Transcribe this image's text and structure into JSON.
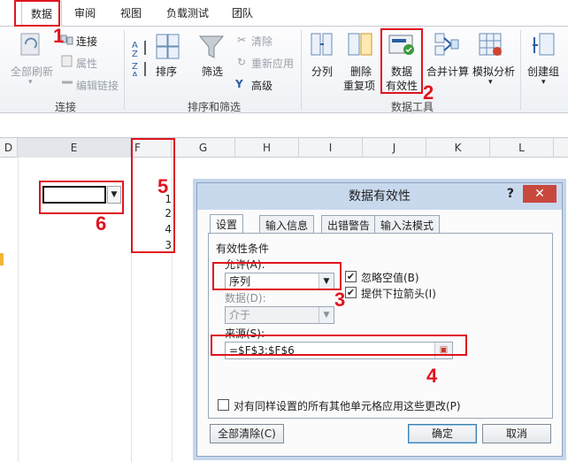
{
  "ribbon_tabs": [
    "数据",
    "审阅",
    "视图",
    "负载测试",
    "团队"
  ],
  "ribbon": {
    "refresh_all": "全部刷新",
    "connections": "连接",
    "properties": "属性",
    "edit_links": "编辑链接",
    "group_connections": "连接",
    "sort": "排序",
    "filter": "筛选",
    "clear": "清除",
    "reapply": "重新应用",
    "advanced": "高级",
    "group_sort_filter": "排序和筛选",
    "text_to_columns": "分列",
    "remove_dup_1": "删除",
    "remove_dup_2": "重复项",
    "data_validation_1": "数据",
    "data_validation_2": "有效性",
    "consolidate": "合并计算",
    "what_if": "模拟分析",
    "group": "创建组",
    "group_data_tools": "数据工具"
  },
  "columns": [
    "D",
    "E",
    "F",
    "G",
    "H",
    "I",
    "J",
    "K",
    "L"
  ],
  "cells": [
    "1",
    "2",
    "4",
    "3"
  ],
  "annotations": [
    "1",
    "2",
    "3",
    "4",
    "5",
    "6"
  ],
  "dialog": {
    "title": "数据有效性",
    "help": "?",
    "close": "✕",
    "tabs": [
      "设置",
      "输入信息",
      "出错警告",
      "输入法模式"
    ],
    "criteria_label": "有效性条件",
    "allow_label": "允许(A):",
    "allow_value": "序列",
    "ignore_blank": "忽略空值(B)",
    "in_cell_dropdown": "提供下拉箭头(I)",
    "data_label": "数据(D):",
    "data_value": "介于",
    "source_label": "来源(S):",
    "source_value": "=$F$3:$F$6",
    "apply_all": "对有同样设置的所有其他单元格应用这些更改(P)",
    "clear_all": "全部清除(C)",
    "ok": "确定",
    "cancel": "取消"
  }
}
